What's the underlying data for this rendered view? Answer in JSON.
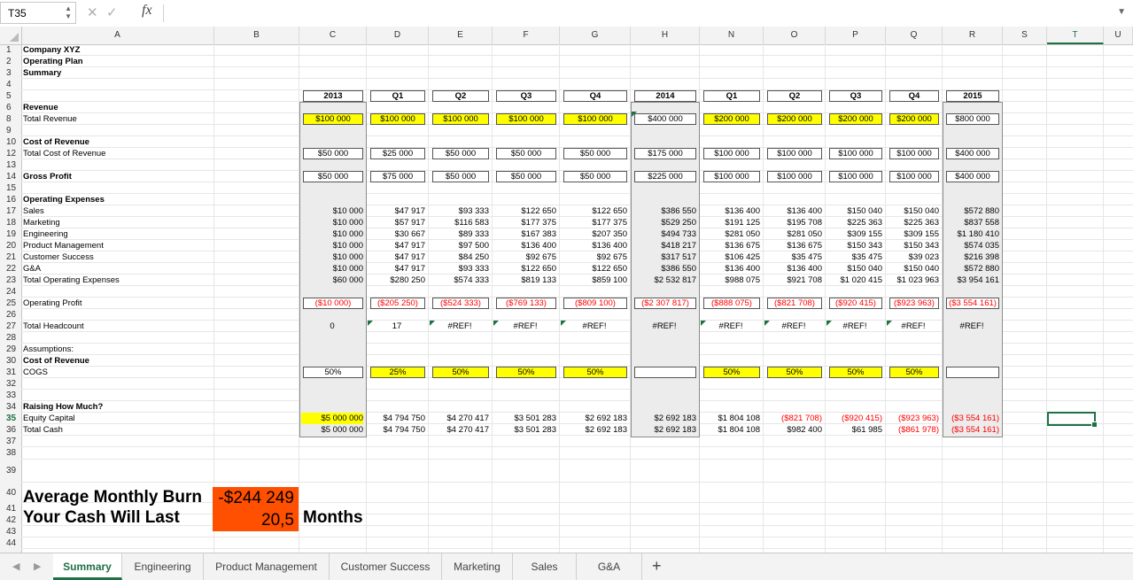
{
  "formula_bar": {
    "cell_ref": "T35",
    "cancel_icon": "✕",
    "confirm_icon": "✓",
    "fx_label": "fx",
    "formula": ""
  },
  "columns": [
    "A",
    "B",
    "C",
    "D",
    "E",
    "F",
    "G",
    "H",
    "N",
    "O",
    "P",
    "Q",
    "R",
    "S",
    "T",
    "U"
  ],
  "rows": [
    "1",
    "2",
    "3",
    "4",
    "5",
    "6",
    "8",
    "9",
    "10",
    "12",
    "13",
    "14",
    "15",
    "16",
    "17",
    "18",
    "19",
    "20",
    "21",
    "22",
    "23",
    "24",
    "25",
    "26",
    "27",
    "28",
    "29",
    "30",
    "31",
    "32",
    "33",
    "34",
    "35",
    "36",
    "37",
    "38",
    "39",
    "40",
    "41",
    "42",
    "43",
    "44"
  ],
  "headers": [
    "2013",
    "Q1",
    "Q2",
    "Q3",
    "Q4",
    "2014",
    "Q1",
    "Q2",
    "Q3",
    "Q4",
    "2015"
  ],
  "labels": {
    "company": "Company XYZ",
    "plan": "Operating Plan",
    "summary": "Summary",
    "revenue": "Revenue",
    "total_revenue": "Total Revenue",
    "cost_of_revenue": "Cost of Revenue",
    "total_cost_of_revenue": "Total Cost of Revenue",
    "gross_profit": "Gross Profit",
    "operating_expenses": "Operating Expenses",
    "sales": "Sales",
    "marketing": "Marketing",
    "engineering": "Engineering",
    "product_management": "Product Management",
    "customer_success": "Customer Success",
    "ga": "G&A",
    "total_operating_expenses": "Total Operating Expenses",
    "operating_profit": "Operating Profit",
    "total_headcount": "Total Headcount",
    "assumptions": "Assumptions:",
    "cogs_header": "Cost of  Revenue",
    "cogs": "COGS",
    "raising": "Raising How Much?",
    "equity_capital": "Equity Capital",
    "total_cash": "Total Cash"
  },
  "values": {
    "total_revenue": [
      "$100 000",
      "$100 000",
      "$100 000",
      "$100 000",
      "$100 000",
      "$400 000",
      "$200 000",
      "$200 000",
      "$200 000",
      "$200 000",
      "$800 000"
    ],
    "total_cost_of_revenue": [
      "$50 000",
      "$25 000",
      "$50 000",
      "$50 000",
      "$50 000",
      "$175 000",
      "$100 000",
      "$100 000",
      "$100 000",
      "$100 000",
      "$400 000"
    ],
    "gross_profit": [
      "$50 000",
      "$75 000",
      "$50 000",
      "$50 000",
      "$50 000",
      "$225 000",
      "$100 000",
      "$100 000",
      "$100 000",
      "$100 000",
      "$400 000"
    ],
    "sales": [
      "$10 000",
      "$47 917",
      "$93 333",
      "$122 650",
      "$122 650",
      "$386 550",
      "$136 400",
      "$136 400",
      "$150 040",
      "$150 040",
      "$572 880"
    ],
    "marketing": [
      "$10 000",
      "$57 917",
      "$116 583",
      "$177 375",
      "$177 375",
      "$529 250",
      "$191 125",
      "$195 708",
      "$225 363",
      "$225 363",
      "$837 558"
    ],
    "engineering": [
      "$10 000",
      "$30 667",
      "$89 333",
      "$167 383",
      "$207 350",
      "$494 733",
      "$281 050",
      "$281 050",
      "$309 155",
      "$309 155",
      "$1 180 410"
    ],
    "product_management": [
      "$10 000",
      "$47 917",
      "$97 500",
      "$136 400",
      "$136 400",
      "$418 217",
      "$136 675",
      "$136 675",
      "$150 343",
      "$150 343",
      "$574 035"
    ],
    "customer_success": [
      "$10 000",
      "$47 917",
      "$84 250",
      "$92 675",
      "$92 675",
      "$317 517",
      "$106 425",
      "$35 475",
      "$35 475",
      "$39 023",
      "$216 398"
    ],
    "ga": [
      "$10 000",
      "$47 917",
      "$93 333",
      "$122 650",
      "$122 650",
      "$386 550",
      "$136 400",
      "$136 400",
      "$150 040",
      "$150 040",
      "$572 880"
    ],
    "total_operating_expenses": [
      "$60 000",
      "$280 250",
      "$574 333",
      "$819 133",
      "$859 100",
      "$2 532 817",
      "$988 075",
      "$921 708",
      "$1 020 415",
      "$1 023 963",
      "$3 954 161"
    ],
    "operating_profit": [
      "($10 000)",
      "($205 250)",
      "($524 333)",
      "($769 133)",
      "($809 100)",
      "($2 307 817)",
      "($888 075)",
      "($821 708)",
      "($920 415)",
      "($923 963)",
      "($3 554 161)"
    ],
    "total_headcount": [
      "0",
      "17",
      "#REF!",
      "#REF!",
      "#REF!",
      "#REF!",
      "#REF!",
      "#REF!",
      "#REF!",
      "#REF!",
      "#REF!"
    ],
    "cogs": [
      "50%",
      "25%",
      "50%",
      "50%",
      "50%",
      "",
      "50%",
      "50%",
      "50%",
      "50%",
      ""
    ],
    "equity_capital": [
      "$5 000 000",
      "$4 794 750",
      "$4 270 417",
      "$3 501 283",
      "$2 692 183",
      "$2 692 183",
      "$1 804 108",
      "($821 708)",
      "($920 415)",
      "($923 963)",
      "($3 554 161)"
    ],
    "total_cash": [
      "$5 000 000",
      "$4 794 750",
      "$4 270 417",
      "$3 501 283",
      "$2 692 183",
      "$2 692 183",
      "$1 804 108",
      "$982 400",
      "$61 985",
      "($861 978)",
      "($3 554 161)"
    ]
  },
  "burn": {
    "label": "Average Monthly Burn",
    "value": "-$244 249",
    "last_label": "Your Cash Will Last",
    "months_value": "20,5",
    "months_label": "Months"
  },
  "tabs": [
    "Summary",
    "Engineering",
    "Product Management",
    "Customer Success",
    "Marketing",
    "Sales",
    "G&A"
  ],
  "active_tab": "Summary",
  "add_sheet": "+",
  "colors": {
    "accent": "#1e7145",
    "highlight": "#ffff00",
    "burn": "#ff4f00",
    "negative": "#ff0000"
  }
}
